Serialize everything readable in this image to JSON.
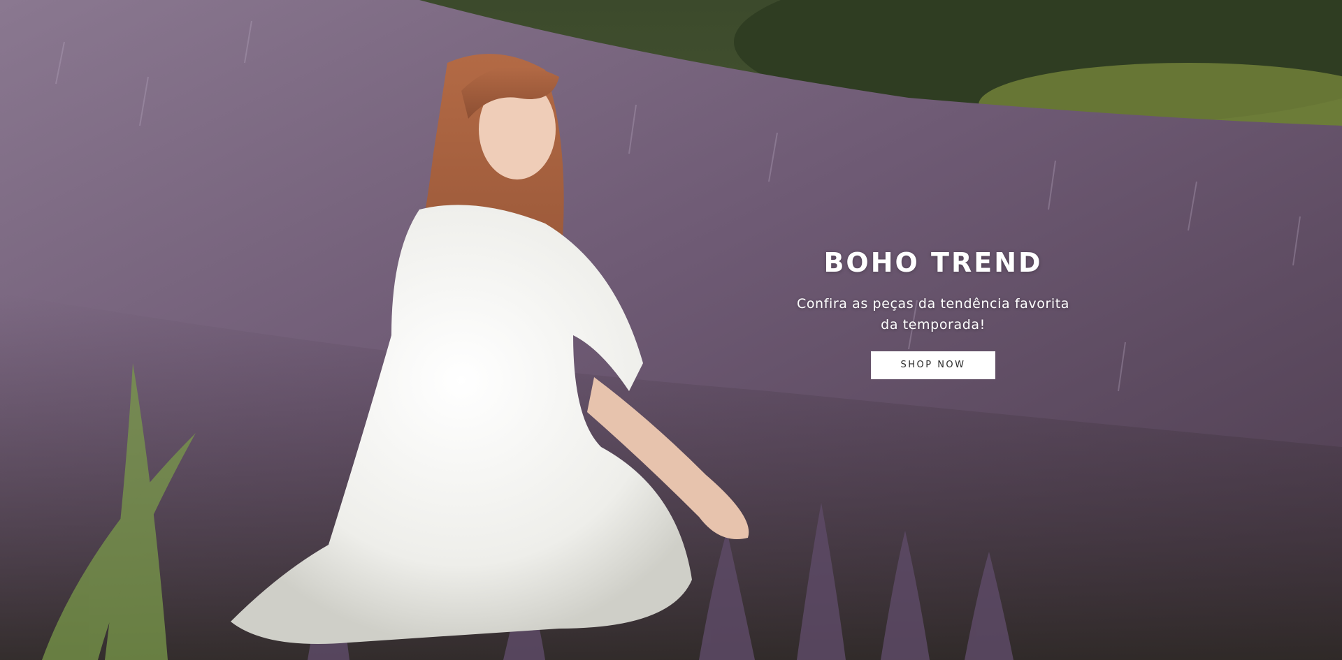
{
  "hero": {
    "title": "BOHO TREND",
    "subtitle": "Confira as peças da tendência favorita da temporada!",
    "cta_label": "SHOP NOW"
  },
  "colors": {
    "cta_background": "#ffffff",
    "cta_text": "#2a2a2a",
    "heading_text": "#ffffff"
  }
}
